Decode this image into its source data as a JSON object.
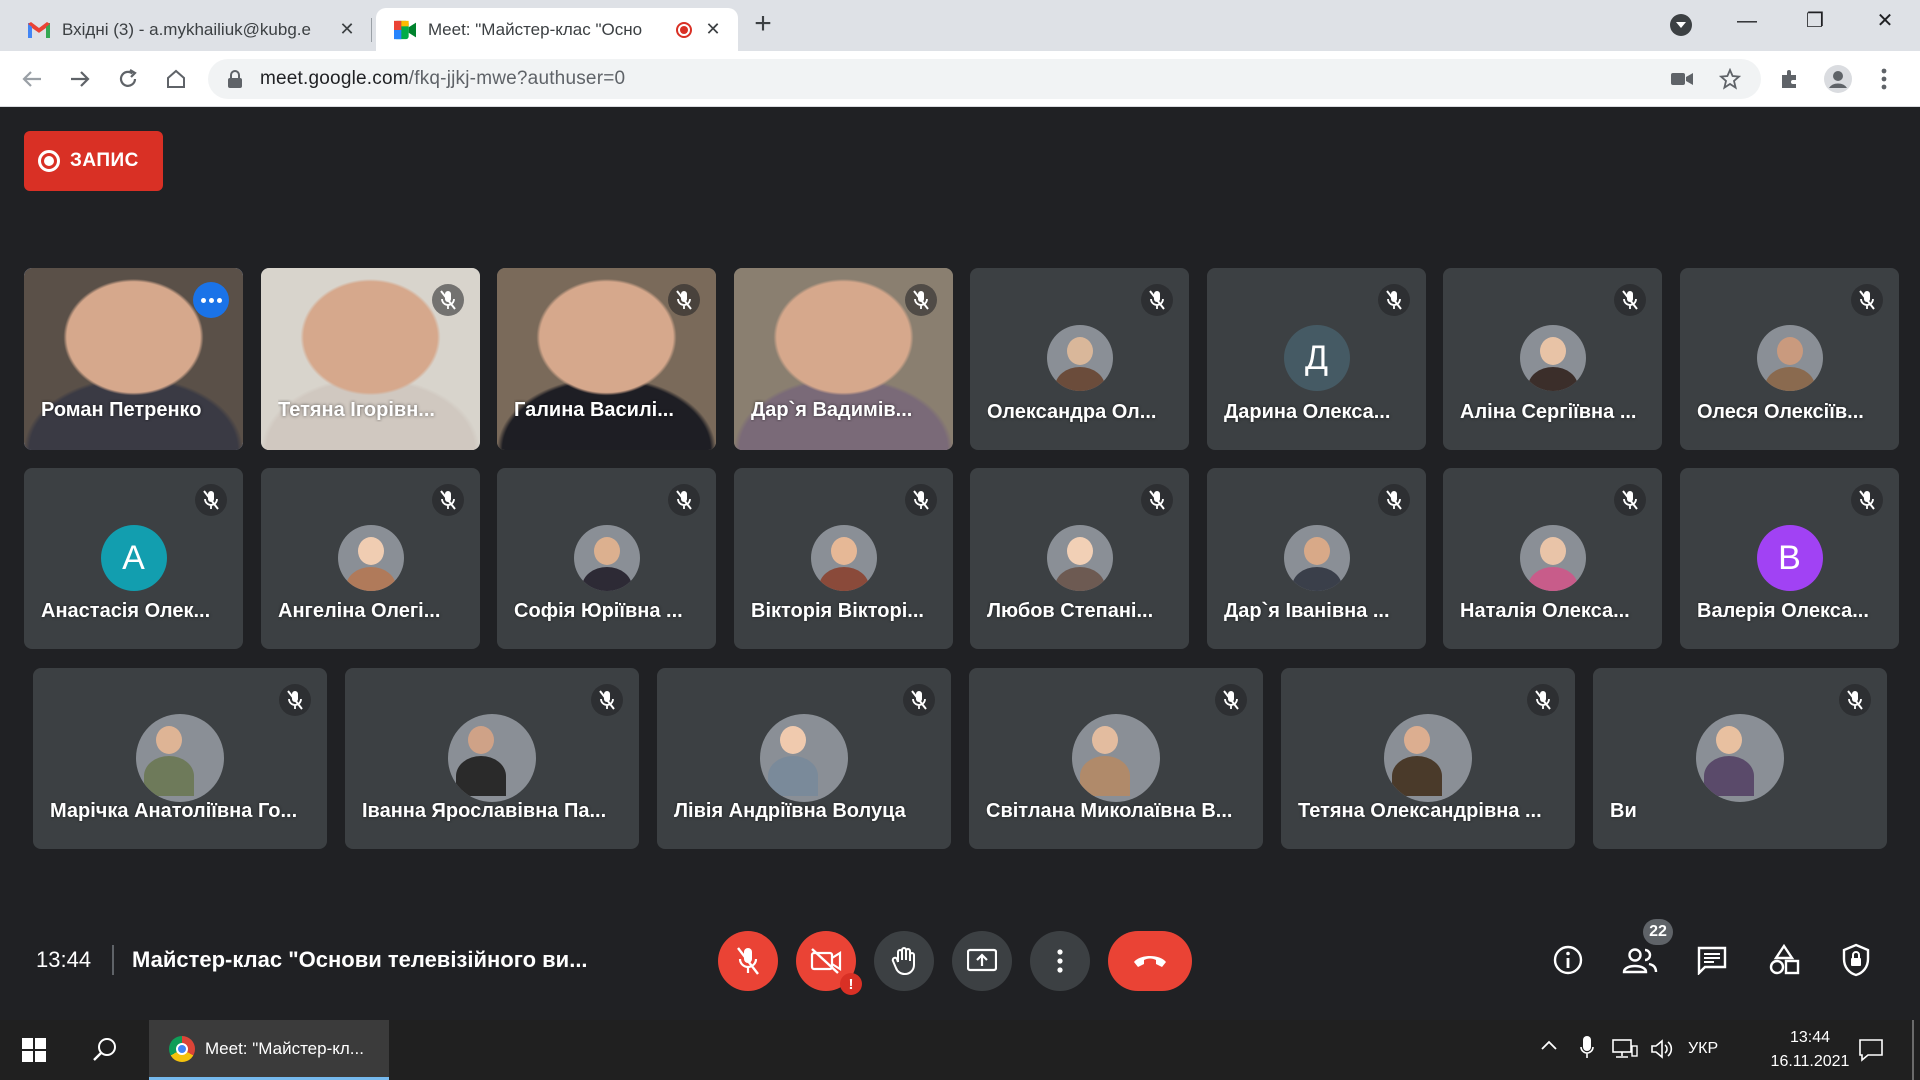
{
  "browser": {
    "tabs": [
      {
        "title": "Вхідні (3) - a.mykhailiuk@kubg.e",
        "close": "✕"
      },
      {
        "title": "Meet: \"Майстер-клас \"Осно",
        "close": "✕"
      }
    ],
    "new_tab": "+",
    "window": {
      "minimize": "—",
      "maximize": "❐",
      "close": "✕"
    },
    "url_host": "meet.google.com",
    "url_path": "/fkq-jjkj-mwe?authuser=0"
  },
  "recording": {
    "label": "ЗАПИС"
  },
  "participants": [
    {
      "name": "Роман Петренко",
      "kind": "video",
      "speaking": true
    },
    {
      "name": "Тетяна Ігорівн...",
      "kind": "video"
    },
    {
      "name": "Галина Василі...",
      "kind": "video"
    },
    {
      "name": "Дар`я Вадимів...",
      "kind": "video"
    },
    {
      "name": "Олександра Ол...",
      "kind": "photo"
    },
    {
      "name": "Дарина Олекса...",
      "kind": "letter",
      "letter": "Д",
      "color": "#455a64"
    },
    {
      "name": "Аліна Сергіївна ...",
      "kind": "photo"
    },
    {
      "name": "Олеся Олексіїв...",
      "kind": "photo"
    },
    {
      "name": "Анастасія Олек...",
      "kind": "letter",
      "letter": "А",
      "color": "#129eaf"
    },
    {
      "name": "Ангеліна Олегі...",
      "kind": "photo"
    },
    {
      "name": "Софія Юріївна ...",
      "kind": "photo"
    },
    {
      "name": "Вікторія Вікторі...",
      "kind": "photo"
    },
    {
      "name": "Любов Степані...",
      "kind": "photo"
    },
    {
      "name": "Дар`я Іванівна ...",
      "kind": "photo"
    },
    {
      "name": "Наталія Олекса...",
      "kind": "photo"
    },
    {
      "name": "Валерія Олекса...",
      "kind": "letter",
      "letter": "В",
      "color": "#a142f4"
    },
    {
      "name": "Марічка Анатоліївна Го...",
      "kind": "photo"
    },
    {
      "name": "Іванна Ярославівна Па...",
      "kind": "photo"
    },
    {
      "name": "Лівія Андріївна Волуца",
      "kind": "photo"
    },
    {
      "name": "Світлана Миколаївна В...",
      "kind": "photo"
    },
    {
      "name": "Тетяна Олександрівна ...",
      "kind": "photo"
    },
    {
      "name": "Ви",
      "kind": "photo"
    }
  ],
  "meeting": {
    "time": "13:44",
    "title": "Майстер-клас \"Основи телевізійного ви...",
    "people_count": "22"
  },
  "taskbar": {
    "app_label": "Meet: \"Майстер-кл...",
    "language": "УКР",
    "time": "13:44",
    "date": "16.11.2021"
  }
}
